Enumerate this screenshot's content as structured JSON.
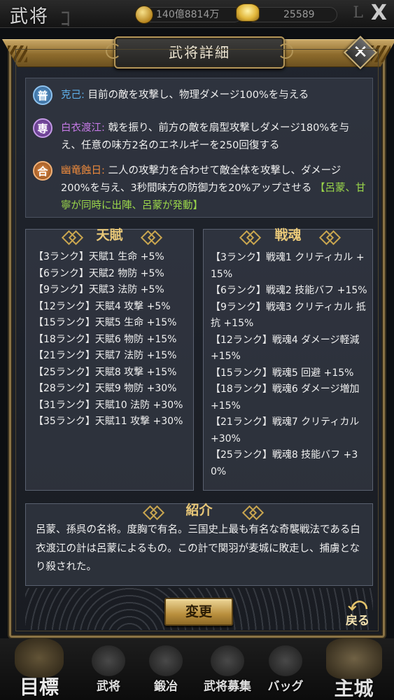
{
  "topbar": {
    "title": "武将",
    "coin_value": "140億8814万",
    "gold_value": "25589",
    "close_label": "X"
  },
  "dialog": {
    "title": "武将詳細",
    "close_label": "✕"
  },
  "skills": [
    {
      "badge": "普",
      "name": "克己:",
      "text": "目前の敵を攻撃し、物理ダメージ100%を与える",
      "combo": ""
    },
    {
      "badge": "専",
      "name": "白衣渡江:",
      "text": "戟を振り、前方の敵を扇型攻撃しダメージ180%を与え、任意の味方2名のエネルギーを250回復する",
      "combo": ""
    },
    {
      "badge": "合",
      "name": "幽竜蝕日:",
      "text": "二人の攻撃力を合わせて敵全体を攻撃し、ダメージ200%を与え、3秒間味方の防御力を20%アップさせる",
      "combo": "【呂蒙、甘寧が同時に出陣、呂蒙が発動】"
    }
  ],
  "talent": {
    "title": "天賦",
    "rows": [
      "【3ランク】天賦1 生命 +5%",
      "【6ランク】天賦2 物防 +5%",
      "【9ランク】天賦3 法防 +5%",
      "【12ランク】天賦4 攻撃 +5%",
      "【15ランク】天賦5 生命 +15%",
      "【18ランク】天賦6 物防 +15%",
      "【21ランク】天賦7 法防 +15%",
      "【25ランク】天賦8 攻撃 +15%",
      "【28ランク】天賦9 物防 +30%",
      "【31ランク】天賦10 法防 +30%",
      "【35ランク】天賦11 攻撃 +30%"
    ]
  },
  "soul": {
    "title": "戦魂",
    "rows": [
      "【3ランク】戦魂1 クリティカル +15%",
      "【6ランク】戦魂2 技能バフ +15%",
      "【9ランク】戦魂3 クリティカル 抵抗 +15%",
      "【12ランク】戦魂4 ダメージ軽減 +15%",
      "【15ランク】戦魂5 回避 +15%",
      "【18ランク】戦魂6 ダメージ増加 +15%",
      "【21ランク】戦魂7 クリティカル +30%",
      "【25ランク】戦魂8 技能バフ +30%"
    ]
  },
  "intro": {
    "title": "紹介",
    "text": "呂蒙、孫呉の名将。度胸で有名。三国史上最も有名な奇襲戦法である白衣渡江の計は呂蒙によるもの。この計で関羽が麦城に敗走し、捕虜となり殺された。"
  },
  "buttons": {
    "change": "変更",
    "back": "戻る"
  },
  "nav": {
    "target": "目標",
    "general": "武将",
    "forge": "鍛冶",
    "recruit": "武将募集",
    "bag": "バッグ",
    "castle": "主城"
  }
}
